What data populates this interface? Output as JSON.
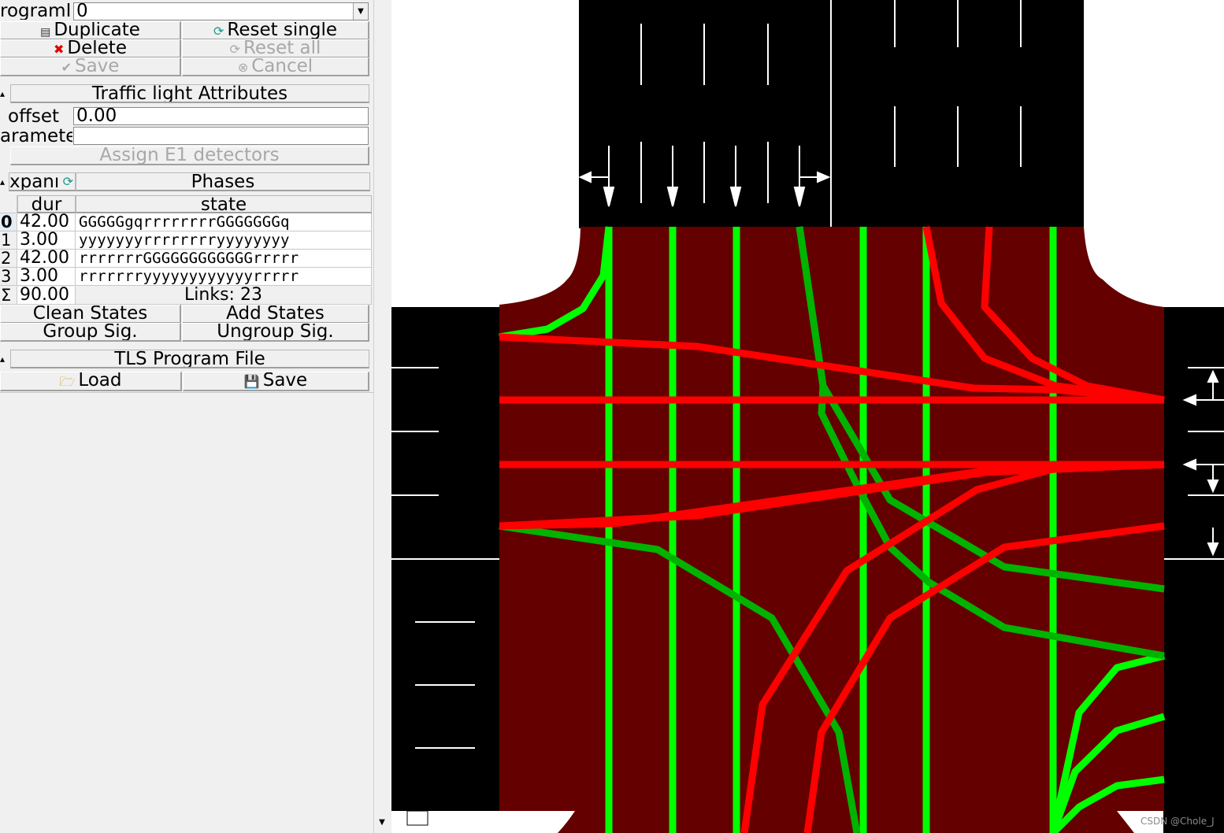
{
  "program_row": {
    "label": "rogramII",
    "value": "0",
    "dropdown_icon": "chevron-down-icon"
  },
  "buttons": {
    "duplicate": "Duplicate",
    "reset_single": "Reset single",
    "delete": "Delete",
    "reset_all": "Reset all",
    "save": "Save",
    "cancel": "Cancel"
  },
  "attributes": {
    "title": "Traffic light Attributes",
    "offset_label": "offset",
    "offset_value": "0.00",
    "parameters_label": "arameteı",
    "parameters_value": "",
    "assign_detectors": "Assign E1 detectors"
  },
  "phases": {
    "expand_label": "xpanı",
    "title": "Phases",
    "col_dur": "dur",
    "col_state": "state",
    "rows": [
      {
        "index": "0",
        "dur": "42.00",
        "state": "GGGGGgqrrrrrrrrGGGGGGGq"
      },
      {
        "index": "1",
        "dur": "3.00",
        "state": "yyyyyyyrrrrrrrryyyyyyyy"
      },
      {
        "index": "2",
        "dur": "42.00",
        "state": "rrrrrrrGGGGGGGGGGGGrrrrr"
      },
      {
        "index": "3",
        "dur": "3.00",
        "state": "rrrrrrryyyyyyyyyyyyrrrrr"
      }
    ],
    "sum_symbol": "Σ",
    "sum_dur": "90.00",
    "links": "Links: 23"
  },
  "phase_buttons": {
    "clean_states": "Clean States",
    "add_states": "Add States",
    "group_sig": "Group Sig.",
    "ungroup_sig": "Ungroup Sig."
  },
  "program_file": {
    "title": "TLS Program File",
    "load": "Load",
    "save": "Save"
  },
  "colors": {
    "junction": "#640000",
    "road": "#000000",
    "green_major": "#00ff00",
    "green_minor": "#00b300",
    "red": "#ff0000"
  },
  "watermark": "CSDN @Chole_J"
}
